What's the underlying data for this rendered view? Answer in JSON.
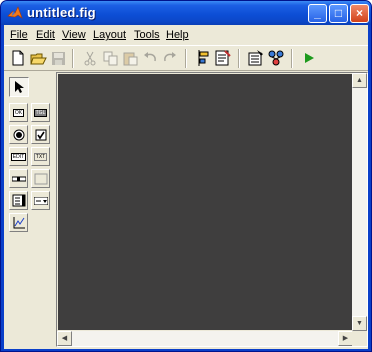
{
  "window": {
    "title": "untitled.fig",
    "controls": {
      "minimize": "_",
      "maximize": "□",
      "close": "×"
    }
  },
  "menubar": {
    "items": [
      {
        "label": "File"
      },
      {
        "label": "Edit"
      },
      {
        "label": "View"
      },
      {
        "label": "Layout"
      },
      {
        "label": "Tools"
      },
      {
        "label": "Help"
      }
    ]
  },
  "toolbar": {
    "buttons": [
      {
        "icon": "new-file-icon",
        "enabled": true
      },
      {
        "icon": "open-folder-icon",
        "enabled": true
      },
      {
        "icon": "save-icon",
        "enabled": false
      },
      {
        "icon": "cut-icon",
        "enabled": false
      },
      {
        "icon": "copy-icon",
        "enabled": false
      },
      {
        "icon": "paste-icon",
        "enabled": false
      },
      {
        "icon": "undo-icon",
        "enabled": false
      },
      {
        "icon": "redo-icon",
        "enabled": false
      },
      {
        "icon": "align-objects-icon",
        "enabled": true
      },
      {
        "icon": "menu-editor-icon",
        "enabled": true
      },
      {
        "icon": "property-inspector-icon",
        "enabled": true
      },
      {
        "icon": "object-browser-icon",
        "enabled": true
      },
      {
        "icon": "run-icon",
        "enabled": true
      }
    ]
  },
  "palette": {
    "tools": [
      {
        "name": "select-tool",
        "icon": "arrow-pointer-icon",
        "selected": true
      },
      {
        "name": "push-button-tool",
        "label": "OK"
      },
      {
        "name": "toggle-button-tool",
        "label": "TGL"
      },
      {
        "name": "radio-button-tool",
        "icon": "radio-icon"
      },
      {
        "name": "checkbox-tool",
        "icon": "checkbox-icon"
      },
      {
        "name": "edit-text-tool",
        "label": "EDIT"
      },
      {
        "name": "static-text-tool",
        "label": "TXT"
      },
      {
        "name": "slider-tool",
        "icon": "slider-icon"
      },
      {
        "name": "frame-tool",
        "icon": "frame-icon"
      },
      {
        "name": "listbox-tool",
        "icon": "listbox-icon"
      },
      {
        "name": "popup-menu-tool",
        "icon": "popup-menu-icon"
      },
      {
        "name": "axes-tool",
        "icon": "axes-icon"
      }
    ]
  },
  "colors": {
    "canvas": "#3f3e3e",
    "client": "#ece9d8",
    "titlebar": "#0d4fd6",
    "run_accent": "#1d9a1d"
  }
}
